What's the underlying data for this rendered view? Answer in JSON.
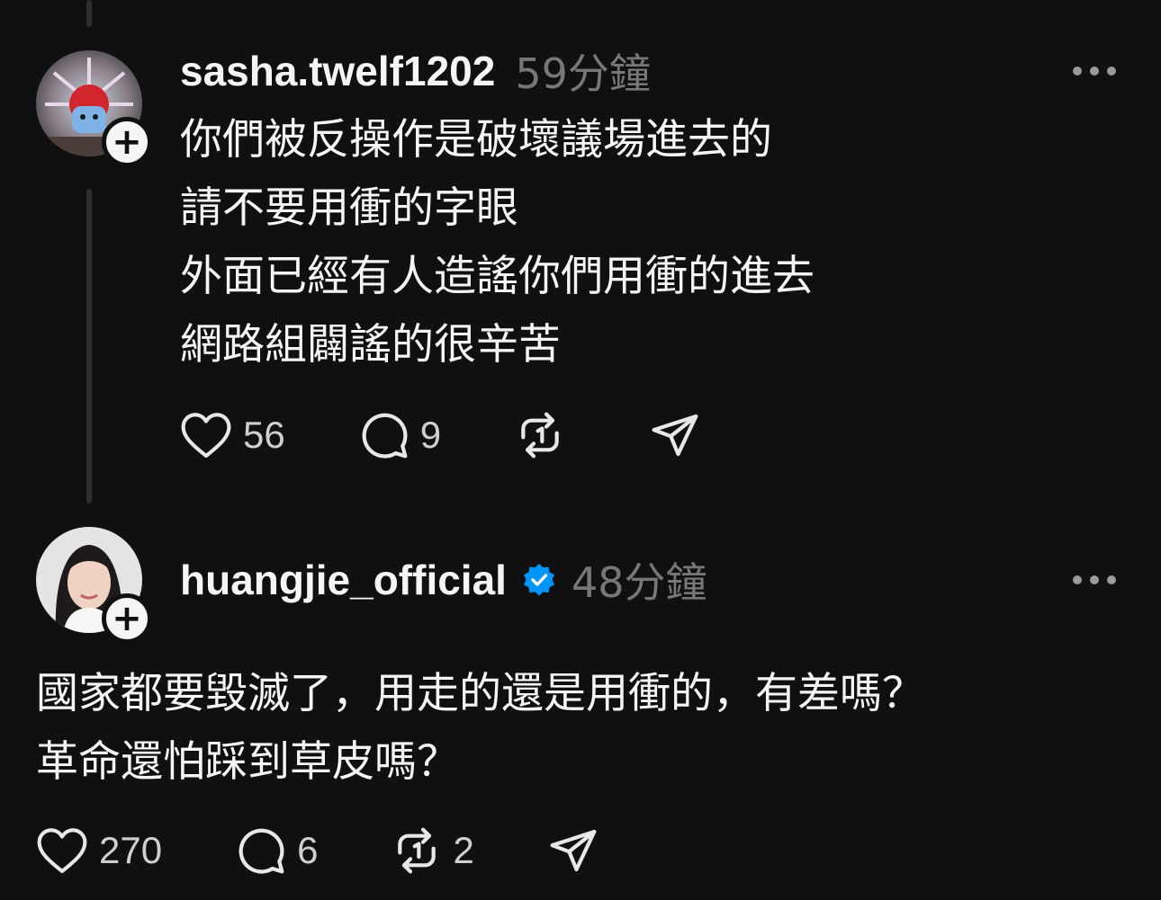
{
  "comments": [
    {
      "username": "sasha.twelf1202",
      "time": "59分鐘",
      "verified": false,
      "lines": [
        "你們被反操作是破壞議場進去的",
        "請不要用衝的字眼",
        "外面已經有人造謠你們用衝的進去",
        "網路組闢謠的很辛苦"
      ],
      "likes": "56",
      "replies": "9",
      "reposts": ""
    },
    {
      "username": "huangjie_official",
      "time": "48分鐘",
      "verified": true,
      "lines": [
        "國家都要毀滅了，用走的還是用衝的，有差嗎？",
        "革命還怕踩到草皮嗎？"
      ],
      "likes": "270",
      "replies": "6",
      "reposts": "2"
    }
  ],
  "icons": {
    "like": "heart-icon",
    "reply": "comment-icon",
    "repost": "repost-icon",
    "share": "send-icon",
    "more": "more-icon",
    "follow": "plus-icon",
    "verified": "verified-badge-icon"
  },
  "colors": {
    "background": "#101010",
    "text": "#f3f5f7",
    "muted": "#777777",
    "verified": "#0095f6"
  }
}
